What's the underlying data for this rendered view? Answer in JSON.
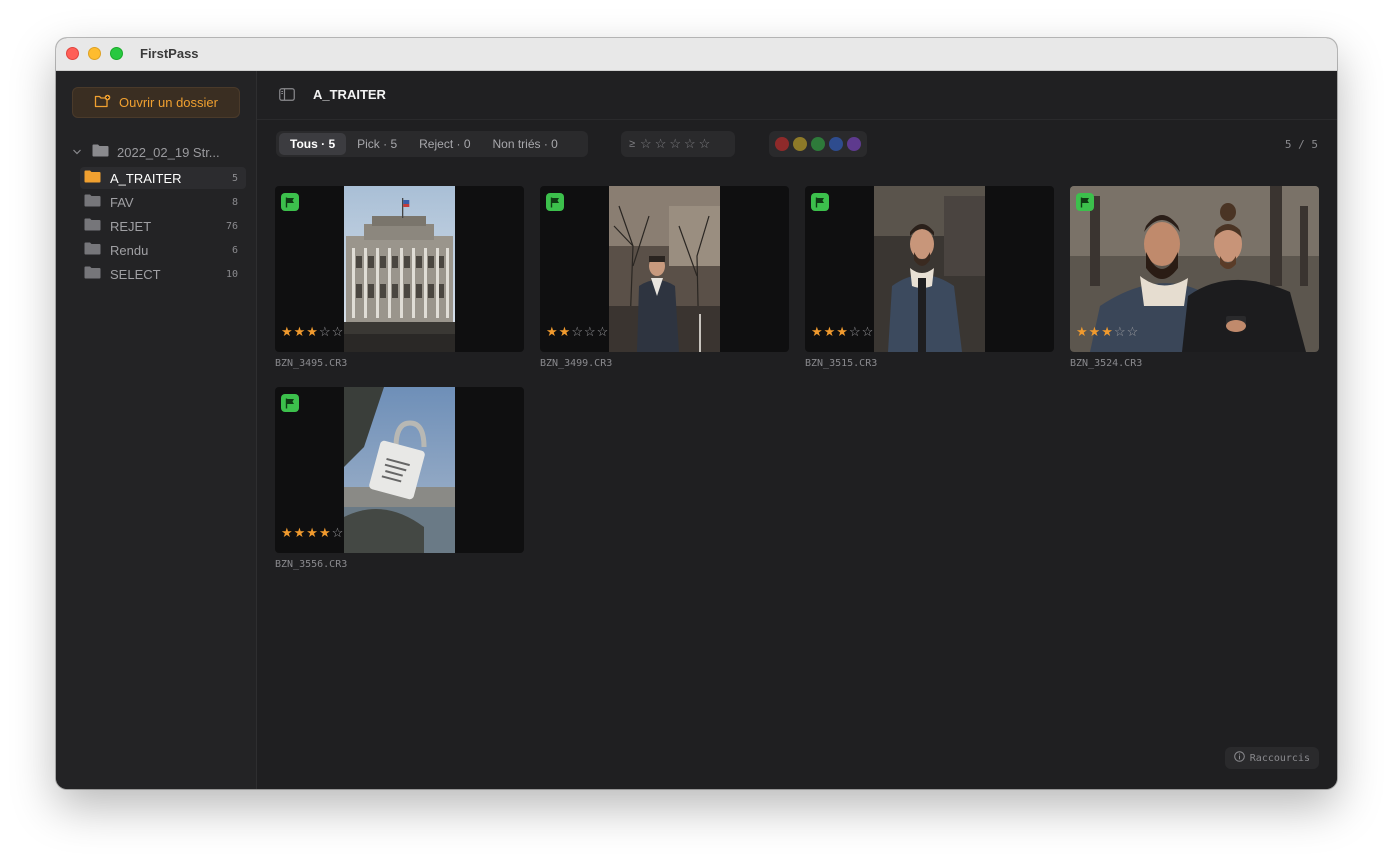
{
  "window": {
    "title": "FirstPass"
  },
  "sidebar": {
    "open_button_label": "Ouvrir un dossier",
    "root_folder": "2022_02_19 Str...",
    "folders": [
      {
        "name": "A_TRAITER",
        "count": "5",
        "active": true
      },
      {
        "name": "FAV",
        "count": "8",
        "active": false
      },
      {
        "name": "REJET",
        "count": "76",
        "active": false
      },
      {
        "name": "Rendu",
        "count": "6",
        "active": false
      },
      {
        "name": "SELECT",
        "count": "10",
        "active": false
      }
    ]
  },
  "header": {
    "folder_title": "A_TRAITER"
  },
  "filters": {
    "tabs": [
      "Tous · 5",
      "Pick · 5",
      "Reject · 0",
      "Non triés · 0"
    ],
    "active_tab": 0,
    "star_prefix": "≥",
    "star_glyph": "☆",
    "colors": [
      "#8e2a2a",
      "#8e7a28",
      "#2e7a3a",
      "#2e4c8e",
      "#5e3a8e"
    ],
    "counter": "5 / 5"
  },
  "photos": [
    {
      "filename": "BZN_3495.CR3",
      "rating": 3,
      "flagged": true,
      "photo": "palace"
    },
    {
      "filename": "BZN_3499.CR3",
      "rating": 2,
      "flagged": true,
      "photo": "man-trees"
    },
    {
      "filename": "BZN_3515.CR3",
      "rating": 3,
      "flagged": true,
      "photo": "man-jacket"
    },
    {
      "filename": "BZN_3524.CR3",
      "rating": 3,
      "flagged": true,
      "photo": "two-men"
    },
    {
      "filename": "BZN_3556.CR3",
      "rating": 4,
      "flagged": true,
      "photo": "padlock"
    }
  ],
  "footer": {
    "shortcuts_label": "Raccourcis"
  },
  "colors": {
    "accent": "#f0a030",
    "flag": "#3cc04c",
    "star": "#f09a2e"
  }
}
